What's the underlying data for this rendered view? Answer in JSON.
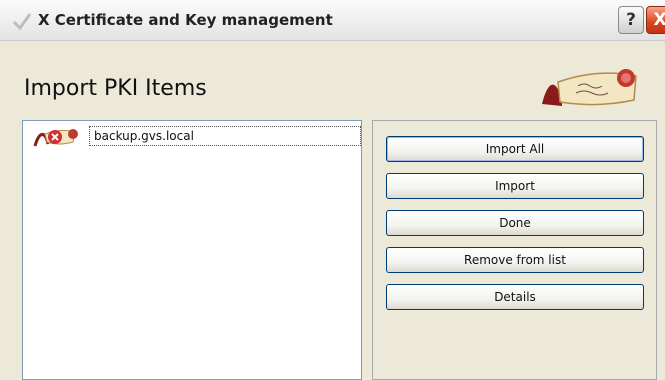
{
  "window": {
    "title": "X Certificate and Key management",
    "help_label": "?",
    "close_label": "X"
  },
  "header": {
    "title": "Import PKI Items",
    "logo_icon": "scroll-seal-logo"
  },
  "list": {
    "items": [
      {
        "label": "backup.gvs.local",
        "icon": "certificate-error-icon"
      }
    ]
  },
  "actions": {
    "import_all": "Import All",
    "import": "Import",
    "done": "Done",
    "remove": "Remove from list",
    "details": "Details"
  },
  "colors": {
    "window_bg": "#ece9d8",
    "border_blue": "#7f9db9",
    "button_border": "#003c74",
    "close_red": "#d9441f"
  }
}
